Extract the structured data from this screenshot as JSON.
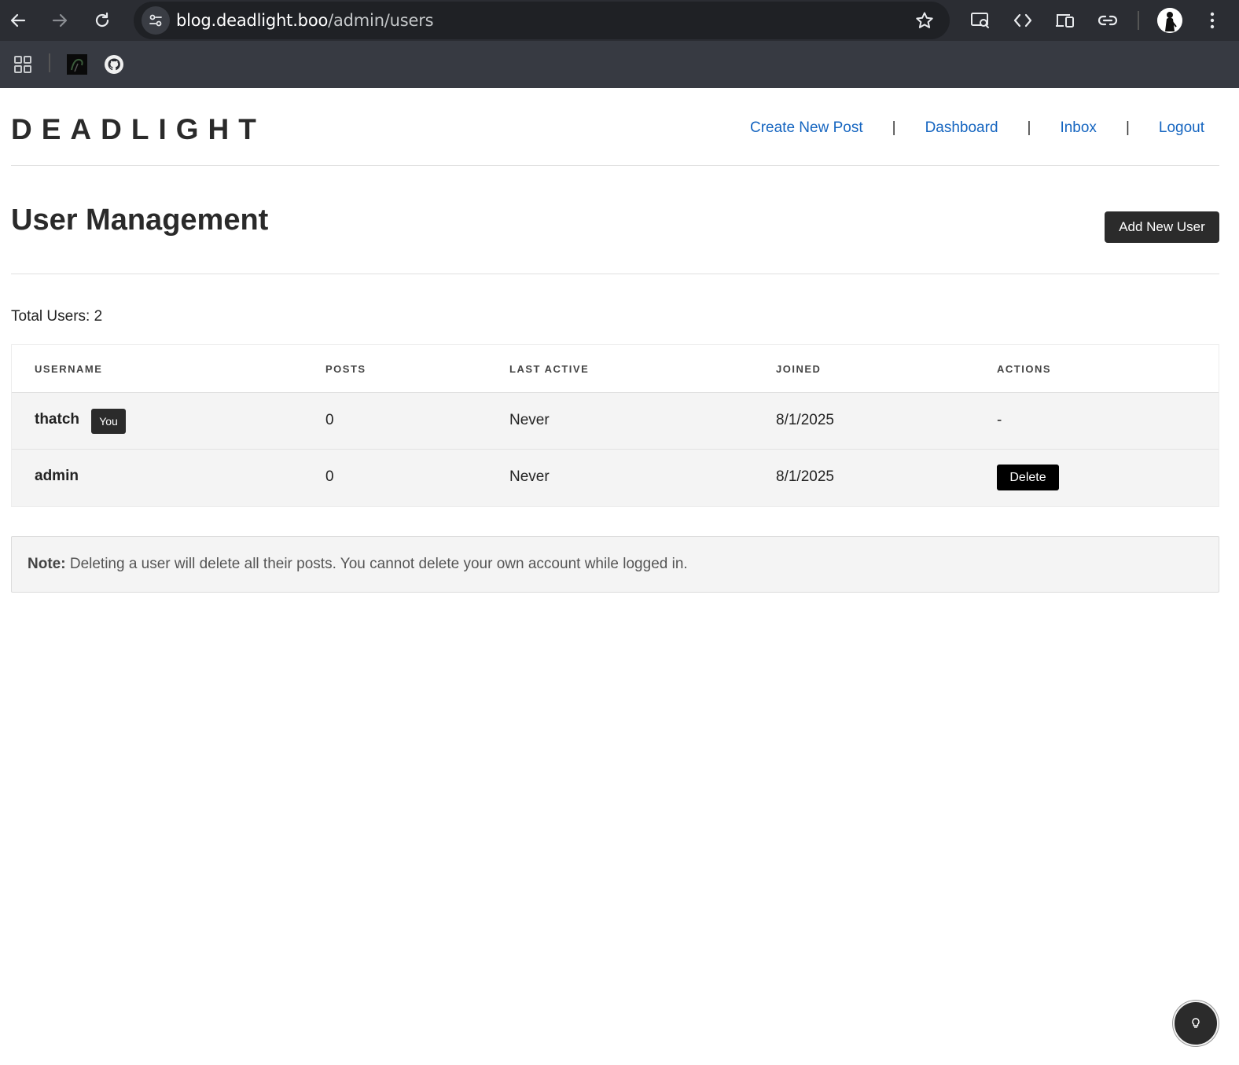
{
  "browser": {
    "url_host": "blog.deadlight.boo",
    "url_path": "/admin/users",
    "icons": [
      "back-icon",
      "forward-icon",
      "reload-icon",
      "site-info-icon",
      "star-icon",
      "screen-search-icon",
      "code-icon",
      "devices-icon",
      "link-icon",
      "profile-avatar",
      "more-icon",
      "apps-icon",
      "bookmark-favicon",
      "github-icon"
    ]
  },
  "header": {
    "logo": "DEADLIGHT",
    "nav": {
      "create_new_post": "Create New Post",
      "dashboard": "Dashboard",
      "inbox": "Inbox",
      "logout": "Logout",
      "separator": "|"
    }
  },
  "main": {
    "title": "User Management",
    "add_user_label": "Add New User",
    "total_users": "Total Users: 2",
    "table": {
      "headers": {
        "username": "USERNAME",
        "posts": "POSTS",
        "last_active": "LAST ACTIVE",
        "joined": "JOINED",
        "actions": "ACTIONS"
      },
      "rows": [
        {
          "username": "thatch",
          "badge": "You",
          "posts": "0",
          "last_active": "Never",
          "joined": "8/1/2025",
          "action": "-"
        },
        {
          "username": "admin",
          "posts": "0",
          "last_active": "Never",
          "joined": "8/1/2025",
          "action": "Delete"
        }
      ]
    },
    "note": {
      "label": "Note:",
      "text": " Deleting a user will delete all their posts. You cannot delete your own account while logged in."
    }
  },
  "colors": {
    "link": "#1565c0",
    "dark_button": "#2b2b2b",
    "delete_button": "#000000",
    "row_bg": "#f4f4f4"
  }
}
